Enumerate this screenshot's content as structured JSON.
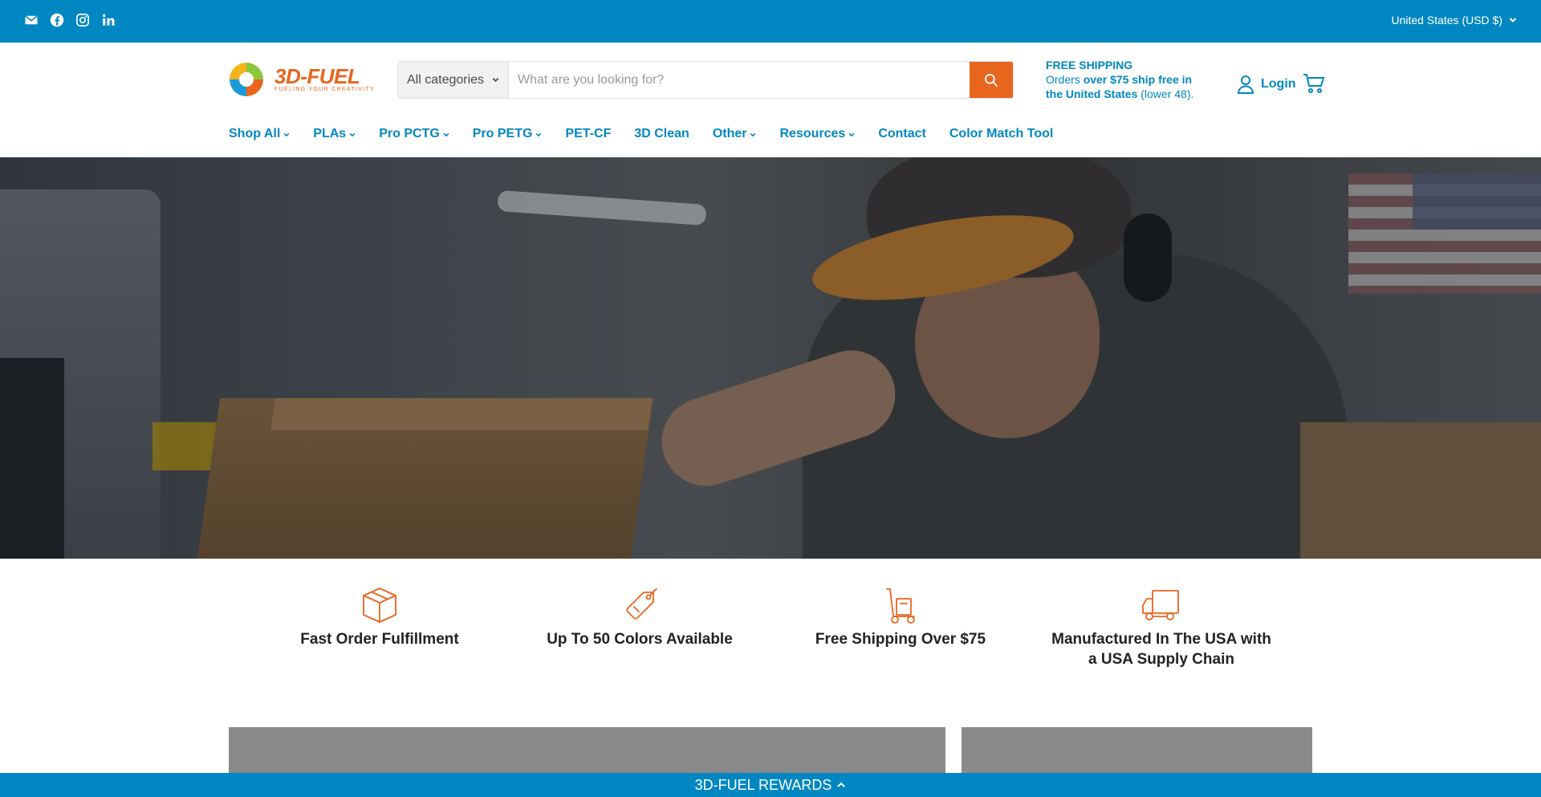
{
  "topbar": {
    "social": [
      "email-icon",
      "facebook-icon",
      "instagram-icon",
      "linkedin-icon"
    ],
    "currency": "United States (USD $)"
  },
  "brand": {
    "name": "3D-FUEL",
    "tagline": "FUELING YOUR CREATIVITY",
    "colors": {
      "primary": "#0087c1",
      "accent": "#e8651e"
    }
  },
  "search": {
    "category": "All categories",
    "placeholder": "What are you looking for?"
  },
  "shipping": {
    "title": "FREE SHIPPING",
    "line_prefix": "Orders ",
    "line_bold_1": "over $75 ship free in",
    "line_bold_2": "the United States",
    "line_suffix": " (lower 48)."
  },
  "account": {
    "login": "Login"
  },
  "nav": [
    {
      "label": "Shop All",
      "dropdown": true
    },
    {
      "label": "PLAs",
      "dropdown": true
    },
    {
      "label": "Pro PCTG",
      "dropdown": true
    },
    {
      "label": "Pro PETG",
      "dropdown": true
    },
    {
      "label": "PET-CF",
      "dropdown": false
    },
    {
      "label": "3D Clean",
      "dropdown": false
    },
    {
      "label": "Other",
      "dropdown": true
    },
    {
      "label": "Resources",
      "dropdown": true
    },
    {
      "label": "Contact",
      "dropdown": false
    },
    {
      "label": "Color Match Tool",
      "dropdown": false
    }
  ],
  "features": [
    {
      "icon": "box-icon",
      "label": "Fast Order Fulfillment"
    },
    {
      "icon": "tag-icon",
      "label": "Up To 50 Colors Available"
    },
    {
      "icon": "hand-truck-icon",
      "label": "Free Shipping Over $75"
    },
    {
      "icon": "delivery-truck-icon",
      "label": "Manufactured In The USA with a USA Supply Chain"
    }
  ],
  "rewards": {
    "label": "3D-FUEL REWARDS"
  }
}
